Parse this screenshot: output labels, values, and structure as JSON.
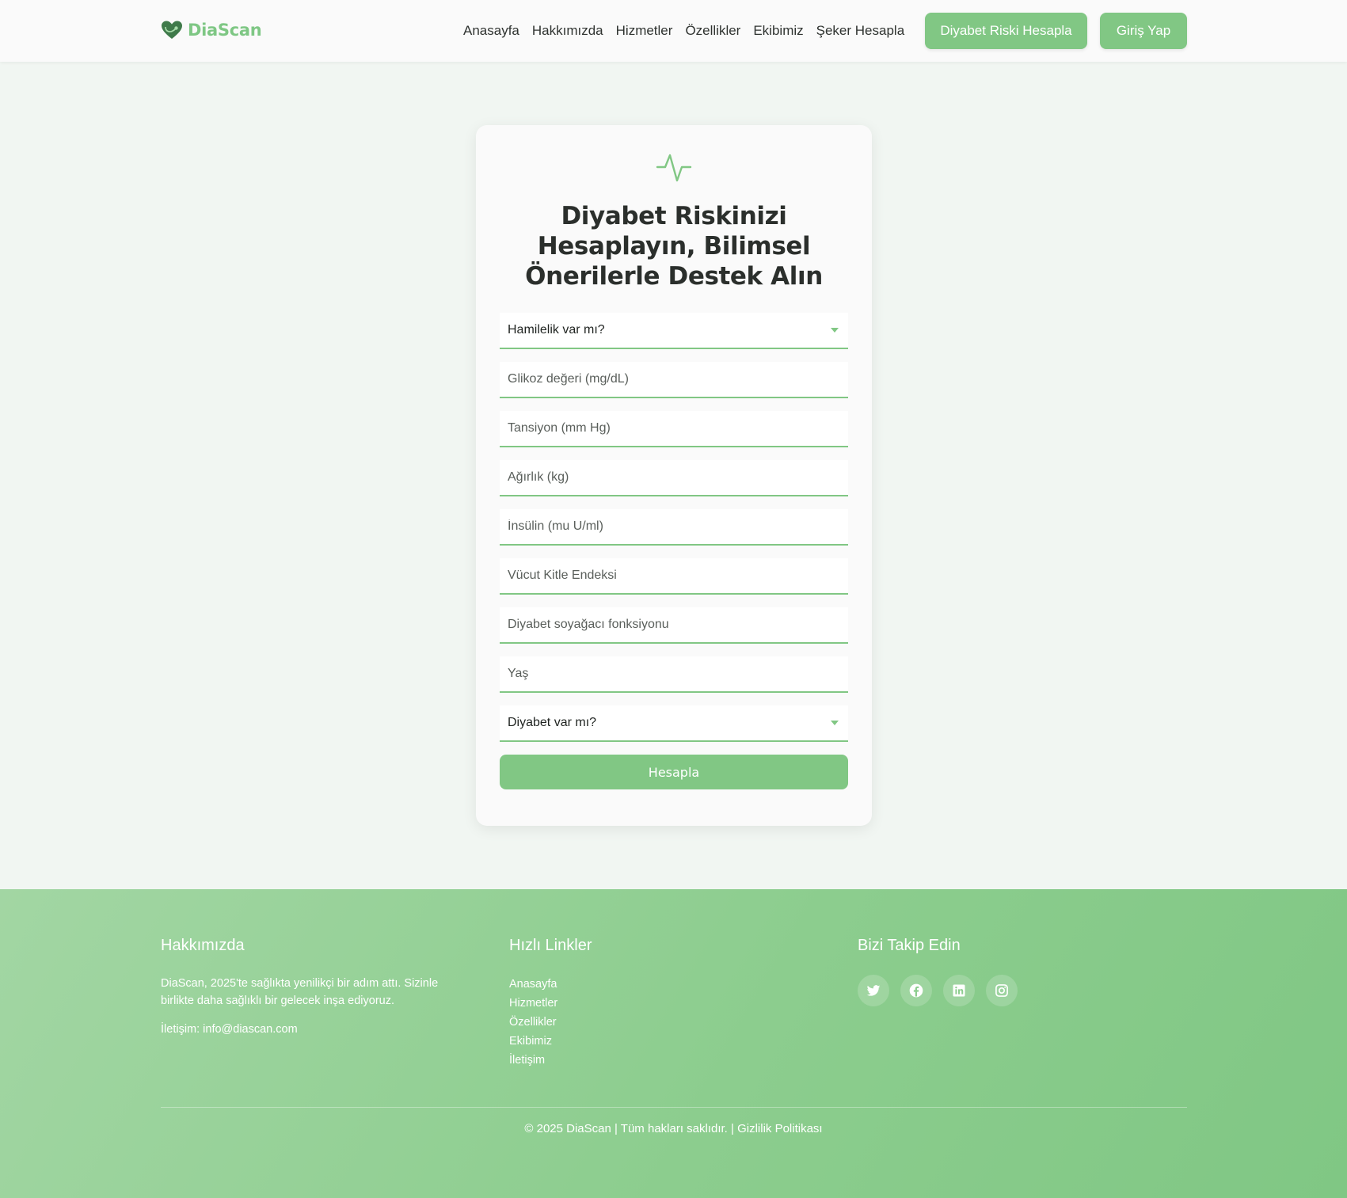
{
  "brand": {
    "name": "DiaScan",
    "accent": "#81c784",
    "logo_icon": "heart-stethoscope-icon"
  },
  "nav": {
    "items": [
      {
        "label": "Anasayfa"
      },
      {
        "label": "Hakkımızda"
      },
      {
        "label": "Hizmetler"
      },
      {
        "label": "Özellikler"
      },
      {
        "label": "Ekibimiz"
      },
      {
        "label": "Şeker Hesapla"
      }
    ],
    "risk_button": "Diyabet Riski Hesapla",
    "login_button": "Giriş Yap"
  },
  "form": {
    "icon": "pulse-icon",
    "title": "Diyabet Riskinizi Hesaplayın, Bilimsel Önerilerle Destek Alın",
    "pregnancy_select": "Hamilelik var mı?",
    "fields": {
      "glucose": "Glikoz değeri (mg/dL)",
      "blood_pressure": "Tansiyon (mm Hg)",
      "weight": "Ağırlık (kg)",
      "insulin": "İnsülin (mu U/ml)",
      "bmi": "Vücut Kitle Endeksi",
      "pedigree": "Diyabet soyağacı fonksiyonu",
      "age": "Yaş"
    },
    "diabetes_select": "Diyabet var mı?",
    "submit": "Hesapla"
  },
  "footer": {
    "about": {
      "title": "Hakkımızda",
      "text": "DiaScan, 2025'te sağlıkta yenilikçi bir adım attı. Sizinle birlikte daha sağlıklı bir gelecek inşa ediyoruz.",
      "contact": "İletişim: info@diascan.com"
    },
    "quick_links": {
      "title": "Hızlı Linkler",
      "items": [
        "Anasayfa",
        "Hizmetler",
        "Özellikler",
        "Ekibimiz",
        "İletişim"
      ]
    },
    "follow": {
      "title": "Bizi Takip Edin",
      "icons": [
        "twitter-icon",
        "facebook-icon",
        "linkedin-icon",
        "instagram-icon"
      ]
    },
    "copyright": "© 2025 DiaScan | Tüm hakları saklıdır. | Gizlilik Politikası"
  }
}
